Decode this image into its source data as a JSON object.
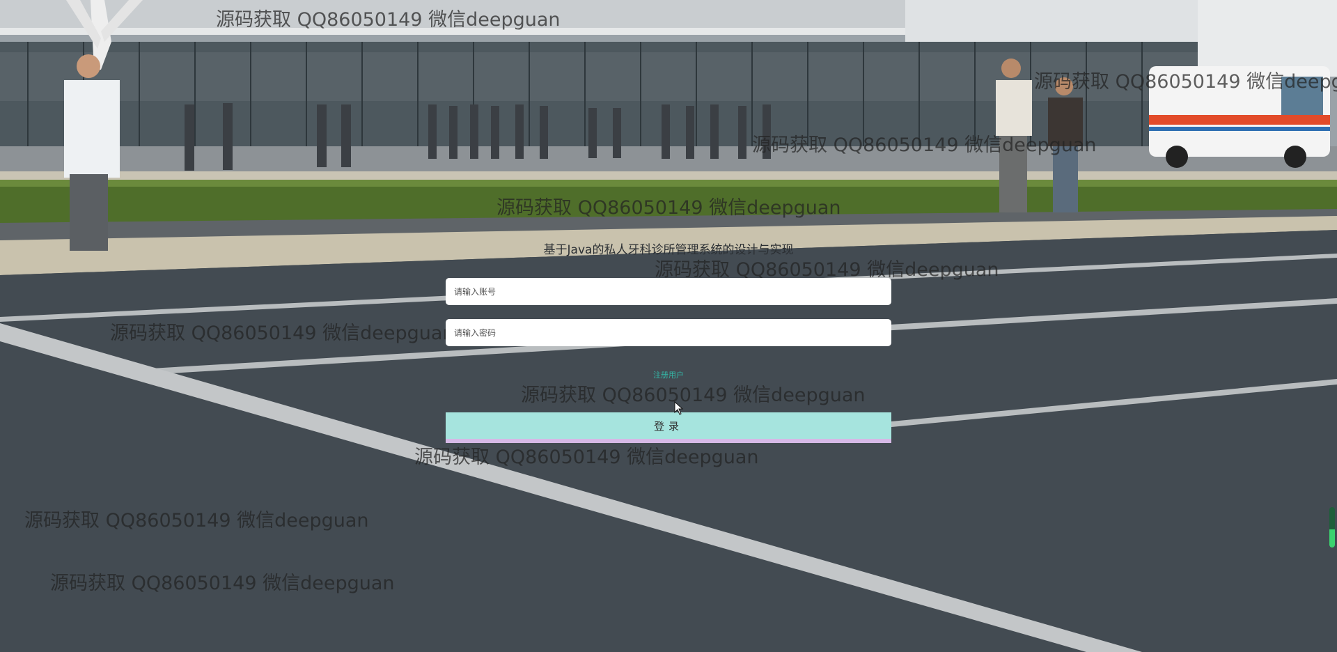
{
  "login": {
    "title": "基于Java的私人牙科诊所管理系统的设计与实现",
    "username_placeholder": "请输入账号",
    "password_placeholder": "请输入密码",
    "register_label": "注册用户",
    "login_label": "登录"
  },
  "watermarks": [
    "源码获取 QQ86050149 微信deepguan",
    "源码获取 QQ86050149 微信deepguan",
    "源码获取 QQ86050149 微信deepguan",
    "源码获取 QQ86050149 微信deepguan",
    "源码获取 QQ86050149 微信deepguan",
    "源码获取 QQ86050149 微信deepguan",
    "源码获取 QQ86050149 微信deepguan",
    "源码获取 QQ86050149 微信deepguan",
    "源码获取 QQ86050149 微信deepguan",
    "源码获取 QQ86050149 微信deepguan",
    "源码获取 QQ86050149 微信deepguan"
  ],
  "colors": {
    "login_button": "#a6e4de",
    "login_button_border": "#d6b9e6",
    "register_link": "#34b6a6"
  }
}
